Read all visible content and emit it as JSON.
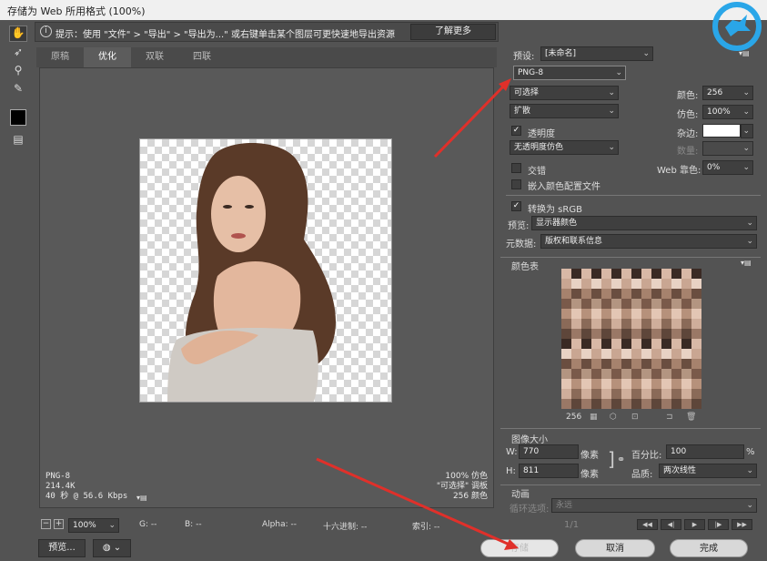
{
  "window": {
    "title": "存储为 Web 所用格式 (100%)"
  },
  "hint": {
    "text": "提示：使用 \"文件\" > \"导出\" > \"导出为...\" 或右键单击某个图层可更快速地导出资源",
    "learn_more": "了解更多"
  },
  "tabs": [
    {
      "label": "原稿"
    },
    {
      "label": "优化"
    },
    {
      "label": "双联"
    },
    {
      "label": "四联"
    }
  ],
  "preview_info": {
    "format": "PNG-8",
    "size": "214.4K",
    "time": "40 秒 @ 56.6 Kbps",
    "dither_pct": "100% 仿色",
    "palette": "\"可选择\" 调板",
    "colors": "256 颜色"
  },
  "status": {
    "zoom": "100%",
    "g": "G: --",
    "b": "B: --",
    "alpha": "Alpha: --",
    "hex": "十六进制: --",
    "index": "索引: --"
  },
  "bottom_buttons": {
    "preview": "预览...",
    "save": "存储",
    "cancel": "取消",
    "done": "完成"
  },
  "settings": {
    "preset_label": "预设:",
    "preset_value": "[未命名]",
    "format": "PNG-8",
    "reduction": "可选择",
    "dither_algo": "扩散",
    "transparency_label": "透明度",
    "transparency_checked": true,
    "trans_dither": "无透明度仿色",
    "interlaced_label": "交错",
    "interlaced_checked": false,
    "embed_profile_label": "嵌入颜色配置文件",
    "embed_checked": false,
    "colors_label": "颜色:",
    "colors_value": "256",
    "dither_label": "仿色:",
    "dither_value": "100%",
    "matte_label": "杂边:",
    "amount_label": "数量:",
    "websnap_label": "Web 靠色:",
    "websnap_value": "0%",
    "convert_srgb_label": "转换为 sRGB",
    "convert_checked": true,
    "preview_label": "预览:",
    "preview_value": "显示器颜色",
    "metadata_label": "元数据:",
    "metadata_value": "版权和联系信息"
  },
  "color_table": {
    "title": "颜色表",
    "count": "256",
    "swatch_colors": [
      "#d8b8a6",
      "#8a6a58",
      "#b39581",
      "#c9a692",
      "#5e463a",
      "#e3c6b4",
      "#a6826d",
      "#3a2a24",
      "#cfae9b",
      "#7a5a4a",
      "#e8d2c4",
      "#9a7866",
      "#b6917b",
      "#6a4e40"
    ]
  },
  "image_size": {
    "title": "图像大小",
    "w_label": "W:",
    "w_value": "770",
    "w_unit": "像素",
    "h_label": "H:",
    "h_value": "811",
    "h_unit": "像素",
    "percent_label": "百分比:",
    "percent_value": "100",
    "percent_unit": "%",
    "quality_label": "品质:",
    "quality_value": "两次线性"
  },
  "animation": {
    "title": "动画",
    "loop_label": "循环选项:",
    "loop_value": "永远",
    "frame": "1/1"
  },
  "colors": {
    "annotation_red": "#e0302a",
    "logo_blue": "#2aa6e8"
  }
}
